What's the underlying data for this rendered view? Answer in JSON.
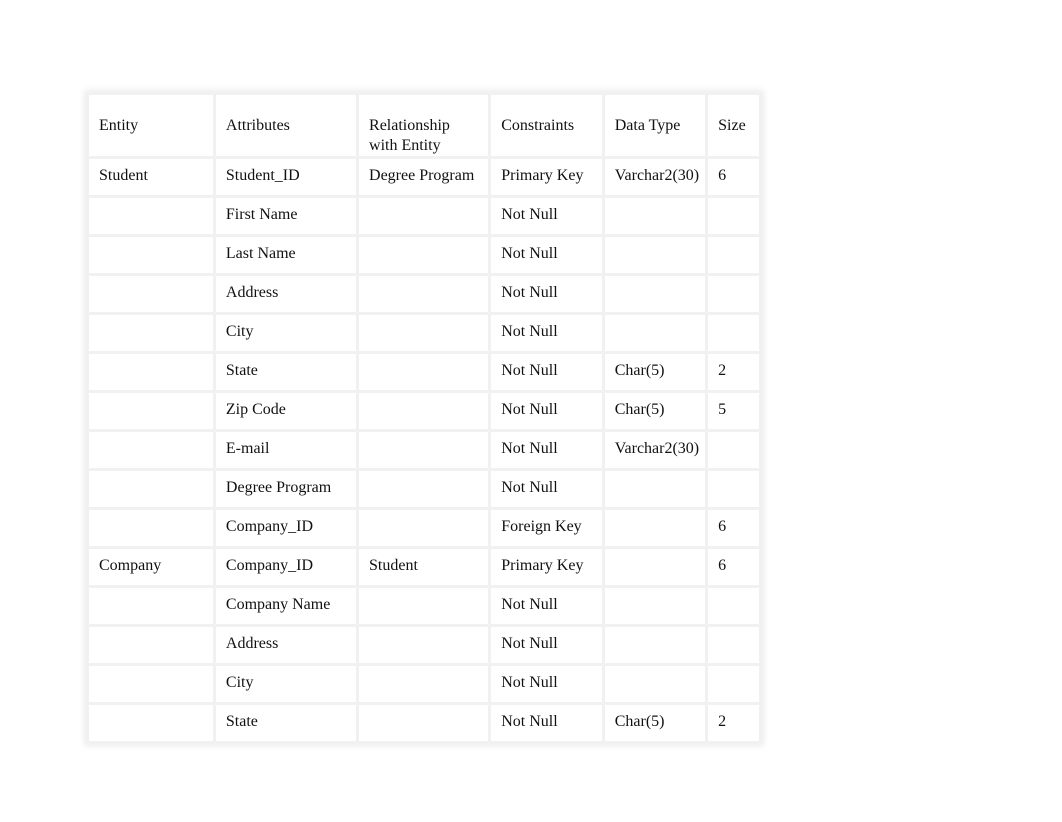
{
  "table": {
    "headers": [
      "Entity",
      "Attributes",
      "Relationship with Entity",
      "Constraints",
      "Data Type",
      "Size"
    ],
    "rows": [
      [
        "Student",
        "Student_ID",
        "Degree Program",
        "Primary Key",
        "Varchar2(30)",
        "6"
      ],
      [
        "",
        "First Name",
        "",
        "Not Null",
        "",
        ""
      ],
      [
        "",
        "Last Name",
        "",
        "Not Null",
        "",
        ""
      ],
      [
        "",
        "Address",
        "",
        "Not Null",
        "",
        ""
      ],
      [
        "",
        "City",
        "",
        "Not Null",
        "",
        ""
      ],
      [
        "",
        "State",
        "",
        "Not Null",
        "Char(5)",
        "2"
      ],
      [
        "",
        "Zip Code",
        "",
        "Not Null",
        "Char(5)",
        "5"
      ],
      [
        "",
        "E-mail",
        "",
        "Not Null",
        "Varchar2(30)",
        ""
      ],
      [
        "",
        "Degree Program",
        "",
        "Not Null",
        "",
        ""
      ],
      [
        "",
        "Company_ID",
        "",
        "Foreign Key",
        "",
        "6"
      ],
      [
        "Company",
        "Company_ID",
        "Student",
        "Primary Key",
        "",
        "6"
      ],
      [
        "",
        "Company Name",
        "",
        "Not Null",
        "",
        ""
      ],
      [
        "",
        "Address",
        "",
        "Not Null",
        "",
        ""
      ],
      [
        "",
        "City",
        "",
        "Not Null",
        "",
        ""
      ],
      [
        "",
        "State",
        "",
        "Not Null",
        "Char(5)",
        "2"
      ]
    ]
  }
}
